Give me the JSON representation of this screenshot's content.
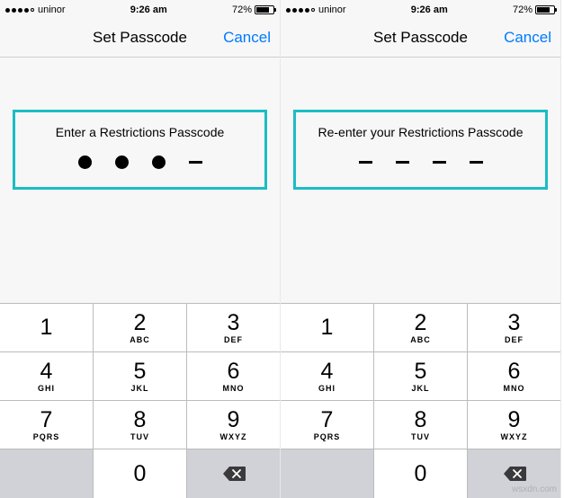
{
  "watermark": "wsxdn.com",
  "screens": [
    {
      "status": {
        "carrier": "uninor",
        "time": "9:26 am",
        "battery": "72%"
      },
      "nav": {
        "title": "Set Passcode",
        "cancel": "Cancel"
      },
      "prompt": "Enter a Restrictions Passcode",
      "digits_entered": 3
    },
    {
      "status": {
        "carrier": "uninor",
        "time": "9:26 am",
        "battery": "72%"
      },
      "nav": {
        "title": "Set Passcode",
        "cancel": "Cancel"
      },
      "prompt": "Re-enter your Restrictions Passcode",
      "digits_entered": 0
    }
  ],
  "keypad": [
    [
      {
        "d": "1",
        "l": ""
      },
      {
        "d": "2",
        "l": "ABC"
      },
      {
        "d": "3",
        "l": "DEF"
      }
    ],
    [
      {
        "d": "4",
        "l": "GHI"
      },
      {
        "d": "5",
        "l": "JKL"
      },
      {
        "d": "6",
        "l": "MNO"
      }
    ],
    [
      {
        "d": "7",
        "l": "PQRS"
      },
      {
        "d": "8",
        "l": "TUV"
      },
      {
        "d": "9",
        "l": "WXYZ"
      }
    ],
    [
      {
        "d": "",
        "l": ""
      },
      {
        "d": "0",
        "l": ""
      },
      {
        "d": "",
        "l": ""
      }
    ]
  ]
}
